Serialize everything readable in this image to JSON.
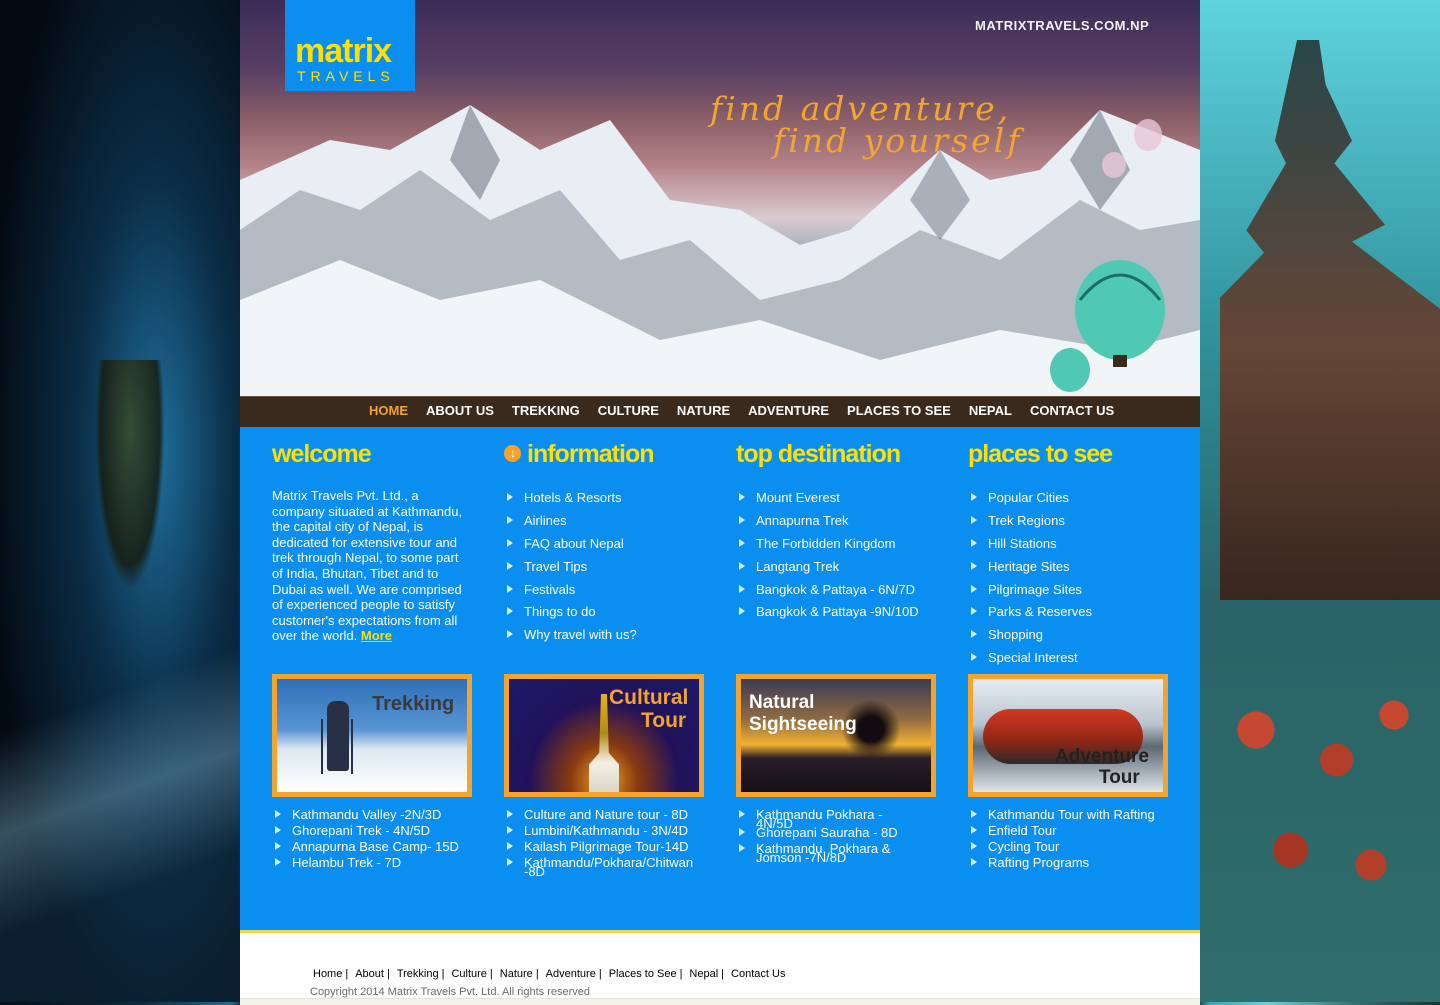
{
  "header": {
    "logo_main": "matrix",
    "logo_sub": "TRAVELS",
    "site_url": "MATRIXTRAVELS.COM.NP",
    "tagline_1": "find adventure,",
    "tagline_2": "find yourself"
  },
  "nav": {
    "items": [
      "HOME",
      "ABOUT US",
      "TREKKING",
      "CULTURE",
      "NATURE",
      "ADVENTURE",
      "PLACES TO SEE",
      "NEPAL",
      "CONTACT US"
    ],
    "active": "HOME"
  },
  "welcome": {
    "heading": "welcome",
    "text": "Matrix Travels Pvt. Ltd., a company situated at Kathmandu, the capital city of Nepal, is dedicated for extensive tour and trek through Nepal, to some part of India, Bhutan, Tibet and to Dubai as well. We are comprised of experienced people to satisfy customer's expectations from all over the world.",
    "more": "More"
  },
  "information": {
    "heading": "information",
    "items": [
      "Hotels & Resorts",
      "Airlines",
      "FAQ about Nepal",
      "Travel Tips",
      "Festivals",
      "Things to do",
      "Why travel with us?"
    ]
  },
  "top_destination": {
    "heading": "top destination",
    "items": [
      "Mount Everest",
      "Annapurna Trek",
      "The Forbidden Kingdom",
      "Langtang Trek",
      "Bangkok & Pattaya - 6N/7D",
      "Bangkok & Pattaya -9N/10D"
    ]
  },
  "places_to_see": {
    "heading": "places to see",
    "items": [
      "Popular Cities",
      "Trek Regions",
      "Hill Stations",
      "Heritage Sites",
      "Pilgrimage Sites",
      "Parks & Reserves",
      "Shopping",
      "Special Interest"
    ]
  },
  "promos": {
    "trekking": {
      "caption": "Trekking",
      "tours": [
        "Kathmandu Valley -2N/3D",
        "Ghorepani Trek - 4N/5D",
        "Annapurna Base Camp- 15D",
        "Helambu Trek - 7D"
      ]
    },
    "cultural": {
      "caption_1": "Cultural",
      "caption_2": "Tour",
      "tours": [
        "Culture and Nature tour - 8D",
        "Lumbini/Kathmandu - 3N/4D",
        "Kailash Pilgrimage Tour-14D",
        "Kathmandu/Pokhara/Chitwan -8D"
      ]
    },
    "natural": {
      "caption_1": "Natural",
      "caption_2": "Sightseeing",
      "tours": [
        "Kathmandu Pokhara - 4N/5D",
        "Ghorepani Sauraha - 8D",
        "Kathmandu, Pokhara & Jomson -7N/8D"
      ]
    },
    "adventure": {
      "caption_1": "Adventure",
      "caption_2": "Tour",
      "tours": [
        "Kathmandu Tour with Rafting",
        "Enfield Tour",
        "Cycling Tour",
        "Rafting Programs"
      ]
    }
  },
  "footer": {
    "links": [
      "Home",
      "About",
      "Trekking",
      "Culture",
      "Nature",
      "Adventure",
      "Places to See",
      "Nepal",
      "Contact Us"
    ],
    "separator": "|",
    "copyright": "Copyright 2014 Matrix Travels Pvt. Ltd. All rights reserved"
  },
  "colors": {
    "accent_yellow": "#ffe000",
    "accent_orange": "#f5a32c",
    "content_blue": "#0a8ef0",
    "nav_brown": "#3a2a1e"
  }
}
